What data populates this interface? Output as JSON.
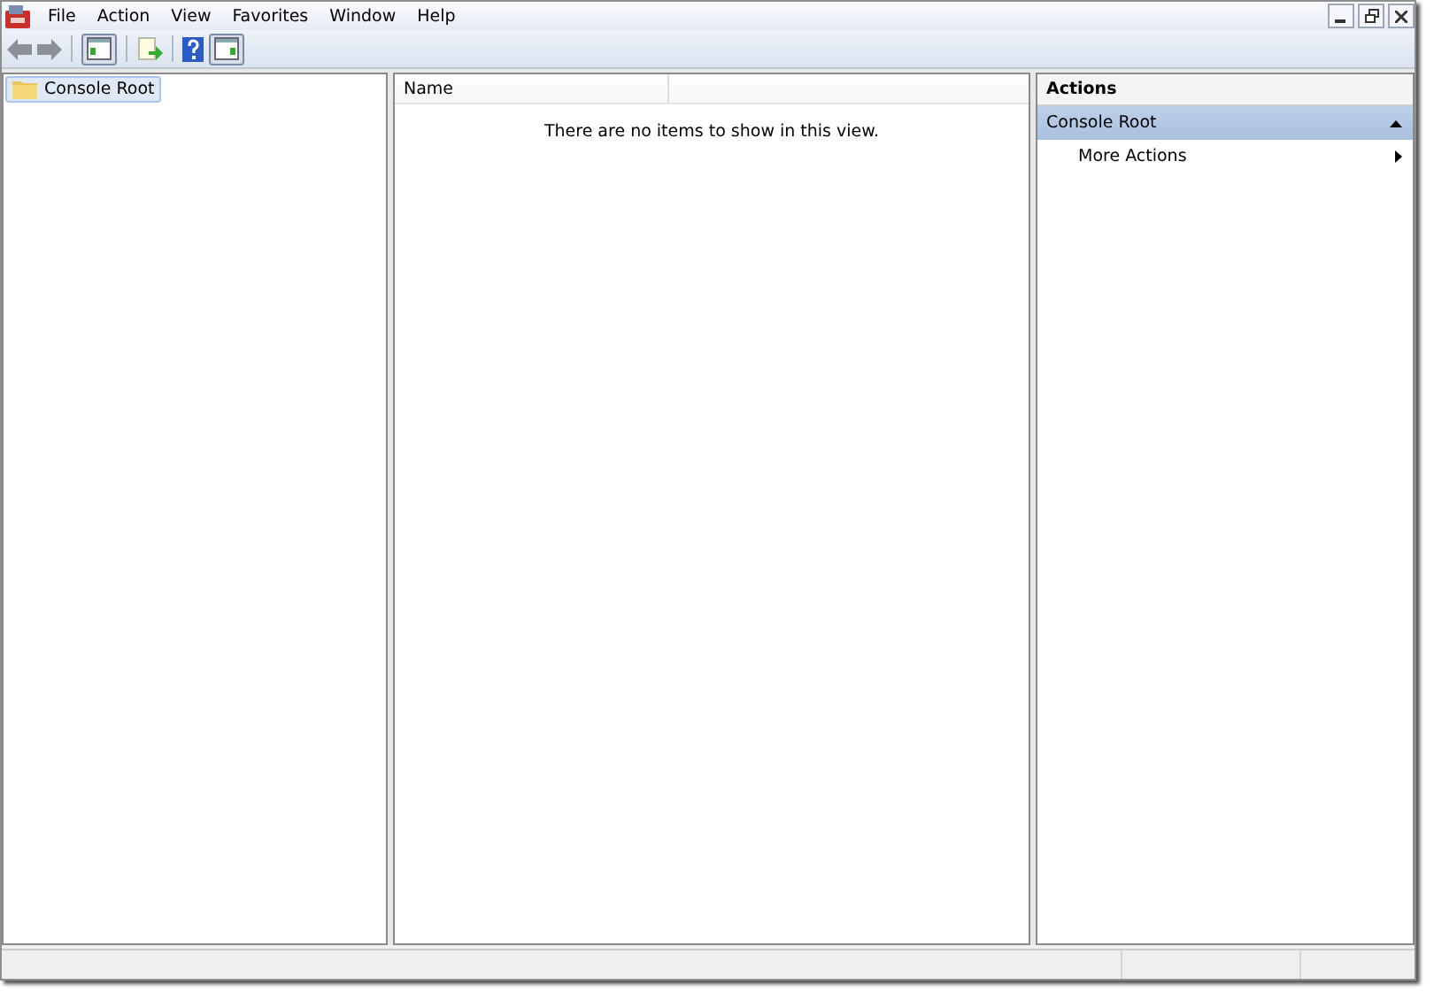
{
  "menu": [
    "File",
    "Action",
    "View",
    "Favorites",
    "Window",
    "Help"
  ],
  "tree": [
    {
      "label": "Console Root",
      "selected": true
    }
  ],
  "list": {
    "columns": [
      "Name"
    ],
    "empty_message": "There are no items to show in this view."
  },
  "actions": {
    "title": "Actions",
    "sections": [
      {
        "label": "Console Root",
        "expanded": true,
        "items": [
          {
            "label": "More Actions"
          }
        ]
      }
    ]
  }
}
